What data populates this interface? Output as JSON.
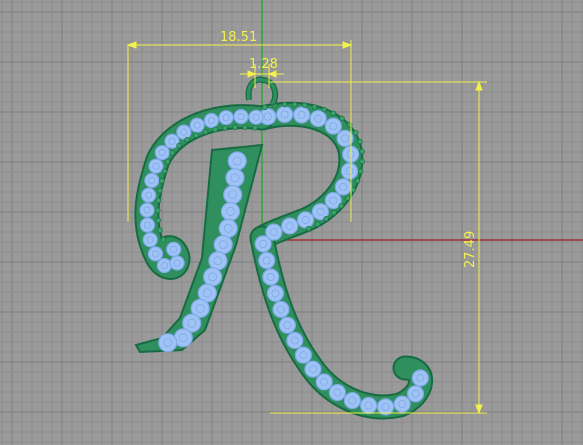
{
  "viewport": {
    "background": "#9a9a9a",
    "grid_minor_color": "#8c8c8c",
    "grid_major_color": "#7e7e7e",
    "x_axis_color": "#a83030",
    "y_axis_color": "#2ea52e"
  },
  "model": {
    "name": "letter R pendant",
    "metal_color": "#2f8f5e",
    "metal_outline": "#176b42",
    "stone_color": "#9fc3f5",
    "stone_facet_color": "#7fa9e8"
  },
  "dimensions": {
    "color": "#f2f24a",
    "width_label": "18.51",
    "bail_label": "1.28",
    "height_label": "27.49"
  }
}
